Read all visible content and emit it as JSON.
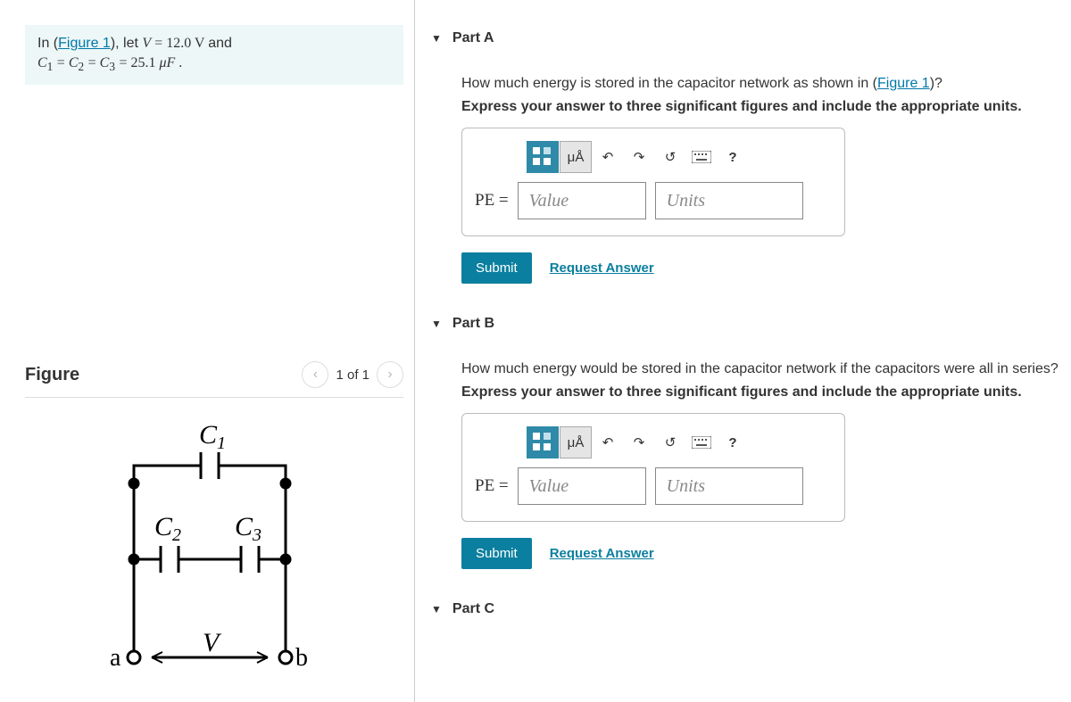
{
  "problem": {
    "prefix": "In (",
    "figure_link": "Figure 1",
    "let_text": "), let ",
    "v_val": " = 12.0",
    "v_unit": "  V ",
    "and": "and",
    "c_eq": " = 25.1  ",
    "c_unit": "μF",
    "period": " ."
  },
  "figure": {
    "title": "Figure",
    "pager": "1 of 1",
    "labels": {
      "c1": "C",
      "c2": "C",
      "c3": "C",
      "a": "a",
      "b": "b",
      "v": "V"
    }
  },
  "parts": [
    {
      "title": "Part A",
      "q_pre": "How much energy is stored in the capacitor network as shown in (",
      "q_link": "Figure 1",
      "q_post": ")?",
      "instr": "Express your answer to three significant figures and include the appropriate units.",
      "lhs": "PE =",
      "value_ph": "Value",
      "units_ph": "Units",
      "mu_label": "μÅ",
      "q_mark": "?",
      "submit": "Submit",
      "request": "Request Answer"
    },
    {
      "title": "Part B",
      "q_full": "How much energy would be stored in the capacitor network if the capacitors were all in series?",
      "instr": "Express your answer to three significant figures and include the appropriate units.",
      "lhs": "PE =",
      "value_ph": "Value",
      "units_ph": "Units",
      "mu_label": "μÅ",
      "q_mark": "?",
      "submit": "Submit",
      "request": "Request Answer"
    },
    {
      "title": "Part C"
    }
  ]
}
